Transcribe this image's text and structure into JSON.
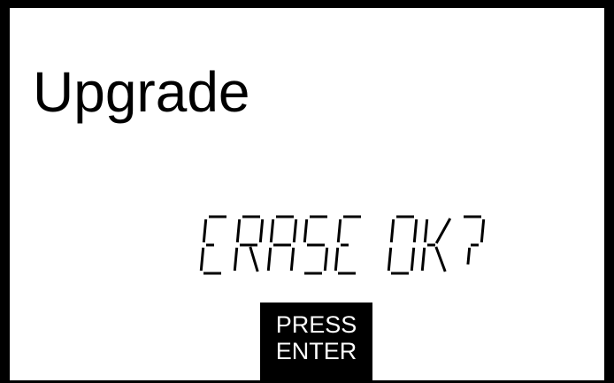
{
  "screen": {
    "title": "Upgrade",
    "message": "ERASE OK?",
    "softkey": {
      "line1": "PRESS",
      "line2": "ENTER"
    }
  },
  "colors": {
    "foreground": "#000000",
    "background": "#ffffff"
  }
}
